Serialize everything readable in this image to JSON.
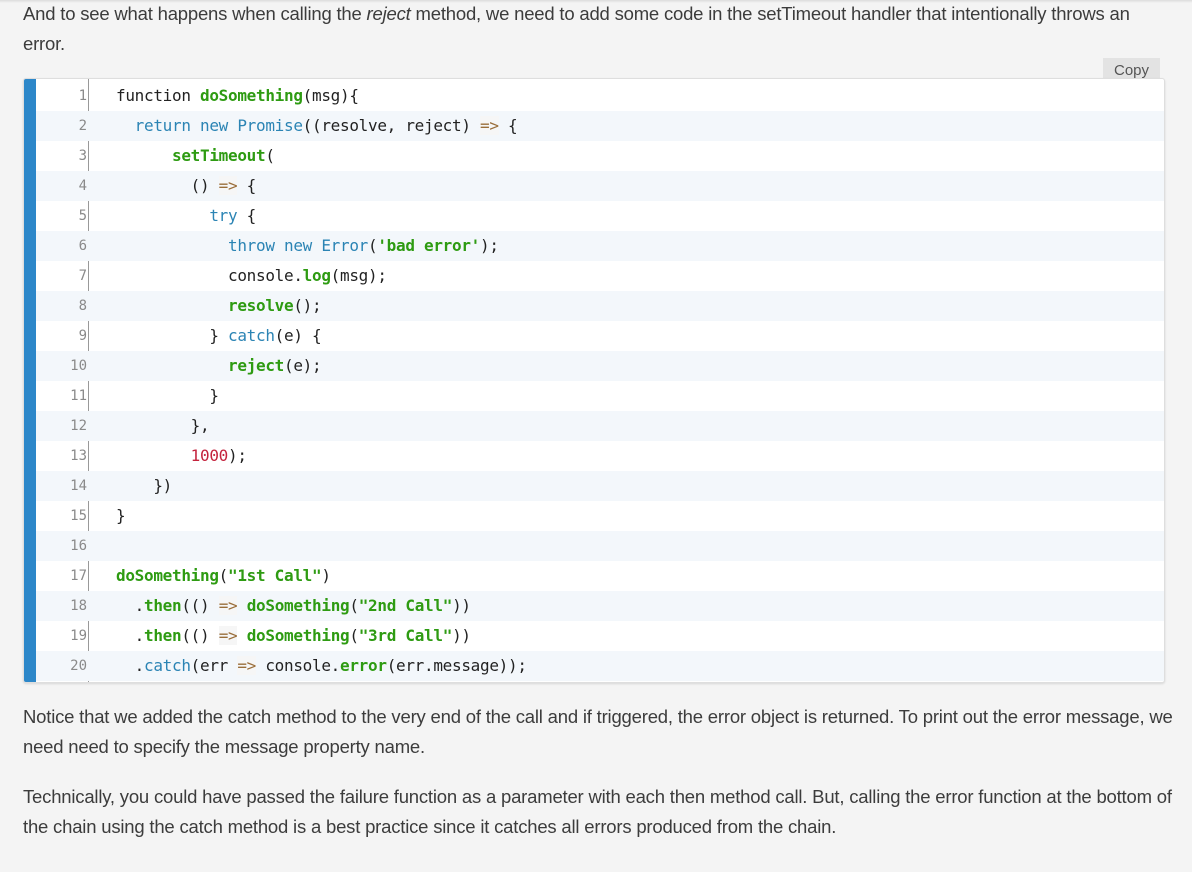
{
  "intro": {
    "before_em": "And to see what happens when calling the ",
    "em": "reject",
    "after_em": " method, we need to add some code in the setTimeout handler that intentionally throws an error."
  },
  "copy_button": {
    "label": "Copy"
  },
  "colors": {
    "accent": "#2c87c9",
    "keyword": "#2b84b4",
    "function": "#2e9b12",
    "number": "#c4233d",
    "operator": "#9a6e3a"
  },
  "code": {
    "language": "javascript",
    "lines": [
      {
        "n": "1",
        "tokens": [
          [
            "pl",
            "function "
          ],
          [
            "fn",
            "doSomething"
          ],
          [
            "pl",
            "(msg){"
          ]
        ]
      },
      {
        "n": "2",
        "tokens": [
          [
            "pl",
            "  "
          ],
          [
            "kw",
            "return new Promise"
          ],
          [
            "pl",
            "((resolve, reject) "
          ],
          [
            "op",
            "=>"
          ],
          [
            "pl",
            " {"
          ]
        ]
      },
      {
        "n": "3",
        "tokens": [
          [
            "pl",
            "      "
          ],
          [
            "fn",
            "setTimeout"
          ],
          [
            "pl",
            "("
          ]
        ]
      },
      {
        "n": "4",
        "tokens": [
          [
            "pl",
            "        () "
          ],
          [
            "op",
            "=>"
          ],
          [
            "pl",
            " {"
          ]
        ]
      },
      {
        "n": "5",
        "tokens": [
          [
            "pl",
            "          "
          ],
          [
            "kw",
            "try"
          ],
          [
            "pl",
            " {"
          ]
        ]
      },
      {
        "n": "6",
        "tokens": [
          [
            "pl",
            "            "
          ],
          [
            "kw",
            "throw new Error"
          ],
          [
            "pl",
            "("
          ],
          [
            "str",
            "'bad error'"
          ],
          [
            "pl",
            ");"
          ]
        ]
      },
      {
        "n": "7",
        "tokens": [
          [
            "pl",
            "            console."
          ],
          [
            "fn",
            "log"
          ],
          [
            "pl",
            "(msg);"
          ]
        ]
      },
      {
        "n": "8",
        "tokens": [
          [
            "pl",
            "            "
          ],
          [
            "fn",
            "resolve"
          ],
          [
            "pl",
            "();"
          ]
        ]
      },
      {
        "n": "9",
        "tokens": [
          [
            "pl",
            "          } "
          ],
          [
            "kw",
            "catch"
          ],
          [
            "pl",
            "(e) {"
          ]
        ]
      },
      {
        "n": "10",
        "tokens": [
          [
            "pl",
            "            "
          ],
          [
            "fn",
            "reject"
          ],
          [
            "pl",
            "(e);"
          ]
        ]
      },
      {
        "n": "11",
        "tokens": [
          [
            "pl",
            "          }"
          ]
        ]
      },
      {
        "n": "12",
        "tokens": [
          [
            "pl",
            "        },"
          ]
        ]
      },
      {
        "n": "13",
        "tokens": [
          [
            "pl",
            "        "
          ],
          [
            "num",
            "1000"
          ],
          [
            "pl",
            ");"
          ]
        ]
      },
      {
        "n": "14",
        "tokens": [
          [
            "pl",
            "    })"
          ]
        ]
      },
      {
        "n": "15",
        "tokens": [
          [
            "pl",
            "}"
          ]
        ]
      },
      {
        "n": "16",
        "tokens": []
      },
      {
        "n": "17",
        "tokens": [
          [
            "fn",
            "doSomething"
          ],
          [
            "pl",
            "("
          ],
          [
            "str",
            "\"1st Call\""
          ],
          [
            "pl",
            ")"
          ]
        ]
      },
      {
        "n": "18",
        "tokens": [
          [
            "pl",
            "  ."
          ],
          [
            "fn",
            "then"
          ],
          [
            "pl",
            "(() "
          ],
          [
            "op",
            "=>"
          ],
          [
            "pl",
            " "
          ],
          [
            "fn",
            "doSomething"
          ],
          [
            "pl",
            "("
          ],
          [
            "str",
            "\"2nd Call\""
          ],
          [
            "pl",
            "))"
          ]
        ]
      },
      {
        "n": "19",
        "tokens": [
          [
            "pl",
            "  ."
          ],
          [
            "fn",
            "then"
          ],
          [
            "pl",
            "(() "
          ],
          [
            "op",
            "=>"
          ],
          [
            "pl",
            " "
          ],
          [
            "fn",
            "doSomething"
          ],
          [
            "pl",
            "("
          ],
          [
            "str",
            "\"3rd Call\""
          ],
          [
            "pl",
            "))"
          ]
        ]
      },
      {
        "n": "20",
        "tokens": [
          [
            "pl",
            "  ."
          ],
          [
            "kw",
            "catch"
          ],
          [
            "pl",
            "(err "
          ],
          [
            "op",
            "=>"
          ],
          [
            "pl",
            " console."
          ],
          [
            "fn",
            "error"
          ],
          [
            "pl",
            "(err.message));"
          ]
        ]
      }
    ]
  },
  "paragraphs": [
    "Notice that we added the catch method to the very end of the call and if triggered, the error object is returned. To print out the error message, we need need to specify the message property name.",
    "Technically, you could have passed the failure function as a parameter with each then method call. But, calling the error function at the bottom of the chain using the catch method is a best practice since it catches all errors produced from the chain."
  ]
}
